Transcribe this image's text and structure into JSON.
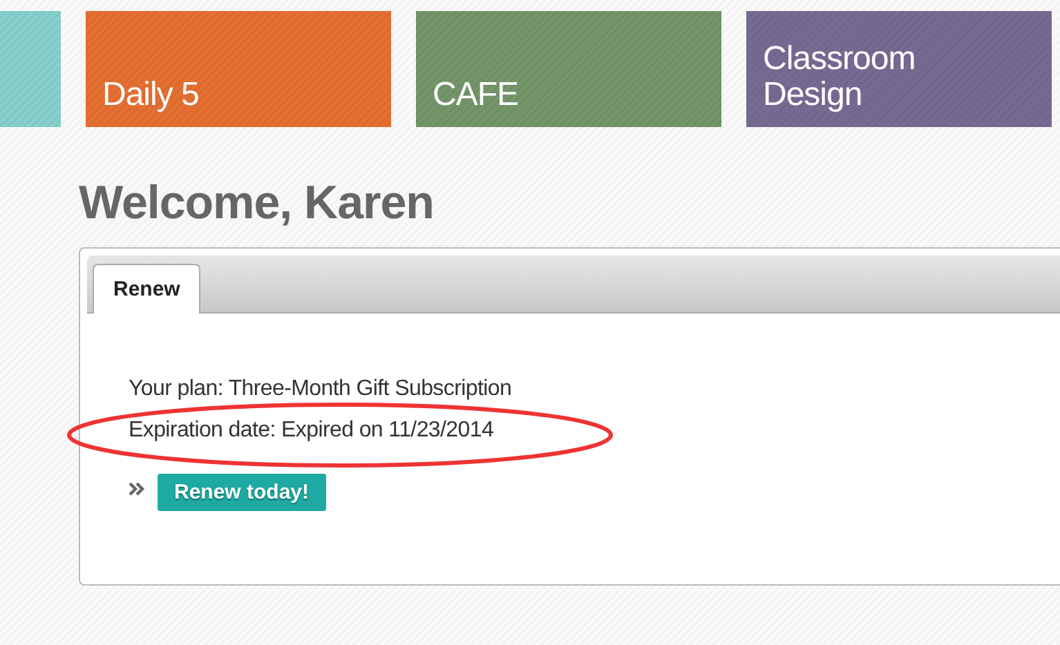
{
  "tiles": [
    {
      "color": "#86cfcc"
    },
    {
      "label": "Daily 5",
      "color": "#e46f31"
    },
    {
      "label": "CAFE",
      "color": "#74956a"
    },
    {
      "label": "Classroom Design",
      "color": "#776a92"
    }
  ],
  "heading": "Welcome, Karen",
  "tabs": [
    {
      "label": "Renew",
      "selected": true
    }
  ],
  "plan": "Your plan: Three-Month Gift Subscription",
  "expiration": "Expiration date: Expired on 11/23/2014",
  "highlighted": true,
  "renew_button": "Renew today!"
}
